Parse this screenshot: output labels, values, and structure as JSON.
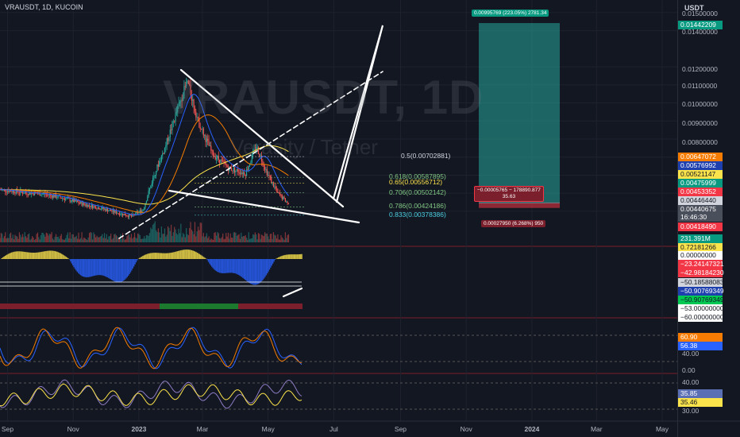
{
  "header": {
    "symbol": "VRAUSDT",
    "interval": "1D",
    "exchange": "KUCOIN",
    "separator": ", "
  },
  "watermark": {
    "symbol": "VRAUSDT",
    "interval_suffix": ", 1D",
    "description": "Verasity / Tether"
  },
  "price_axis": {
    "currency": "USDT",
    "labels": [
      "0.01500000",
      "0.01400000",
      "0.01200000",
      "0.01100000",
      "0.01000000",
      "0.00900000",
      "0.00800000"
    ]
  },
  "price_tags": [
    {
      "text": "0.01442209",
      "bg": "#089981",
      "fg": "#ffffff"
    },
    {
      "text": "0.00647072",
      "bg": "#f57c00",
      "fg": "#ffffff"
    },
    {
      "text": "0.00576992",
      "bg": "#1e40af",
      "fg": "#ffffff"
    },
    {
      "text": "0.00521147",
      "bg": "#fbe34b",
      "fg": "#131722"
    },
    {
      "text": "0.00475999",
      "bg": "#089981",
      "fg": "#ffffff"
    },
    {
      "text": "0.00453352",
      "bg": "#f23645",
      "fg": "#ffffff"
    },
    {
      "text": "0.00446440",
      "bg": "#d1d4dc",
      "fg": "#131722"
    },
    {
      "text": "0.00440675",
      "bg": "#4a4f5c",
      "fg": "#ffffff"
    },
    {
      "text": "16:46:30",
      "bg": "#4a4f5c",
      "fg": "#ffffff"
    },
    {
      "text": "0.00418490",
      "bg": "#f23645",
      "fg": "#ffffff"
    },
    {
      "text": "231.391M",
      "bg": "#089981",
      "fg": "#ffffff"
    },
    {
      "text": "0.72181266",
      "bg": "#fbe34b",
      "fg": "#131722"
    },
    {
      "text": "0.00000000",
      "bg": "#ffffff",
      "fg": "#131722"
    },
    {
      "text": "−23.24147321",
      "bg": "#f23645",
      "fg": "#ffffff"
    },
    {
      "text": "−42.98184230",
      "bg": "#f23645",
      "fg": "#ffffff"
    },
    {
      "text": "−50.18588083",
      "bg": "#d1d4dc",
      "fg": "#131722"
    },
    {
      "text": "−50.90769349",
      "bg": "#1e40af",
      "fg": "#ffffff"
    },
    {
      "text": "−50.90769349",
      "bg": "#00c853",
      "fg": "#131722"
    },
    {
      "text": "−53.00000000",
      "bg": "#ffffff",
      "fg": "#131722"
    },
    {
      "text": "−60.00000000",
      "bg": "#ffffff",
      "fg": "#131722"
    }
  ],
  "stoch_axis": {
    "tags": [
      {
        "text": "60.90",
        "bg": "#f57c00",
        "fg": "#ffffff"
      },
      {
        "text": "56.38",
        "bg": "#2962ff",
        "fg": "#ffffff"
      }
    ],
    "labels": [
      "40.00",
      "0.00"
    ]
  },
  "rsi_axis": {
    "labels": [
      "40.00",
      "30.00"
    ],
    "tags": [
      {
        "text": "35.85",
        "bg": "#5b6fb5",
        "fg": "#ffffff"
      },
      {
        "text": "35.46",
        "bg": "#fbe34b",
        "fg": "#131722"
      }
    ]
  },
  "fib_levels": [
    {
      "label": "0.5(0.00702881)",
      "color": "#d1d4dc"
    },
    {
      "label": "0.618(0.00587895)",
      "color": "#81c784"
    },
    {
      "label": "0.65(0.00556712)",
      "color": "#fbe34b"
    },
    {
      "label": "0.706(0.00502142)",
      "color": "#81c784"
    },
    {
      "label": "0.786(0.00424186)",
      "color": "#81c784"
    },
    {
      "label": "0.833(0.00378386)",
      "color": "#4dd0e1"
    }
  ],
  "position_tool": {
    "target_label": "0.00995769 (223.05%) 2781.34",
    "pnl_label": "−0.00005765 − 178890.877",
    "ratio_label": "35.63",
    "stop_label": "0.00027950 (6.268%) 950"
  },
  "x_axis": {
    "labels": [
      "Sep",
      "Nov",
      "2023",
      "Mar",
      "May",
      "Jul",
      "Sep",
      "Nov",
      "2024",
      "Mar",
      "May"
    ]
  },
  "colors": {
    "background": "#131722",
    "up": "#26a69a",
    "down": "#ef5350",
    "ema_slow": "#fbe34b",
    "ema_fast": "#f57c00",
    "drawing": "#ffffff"
  },
  "chart_data": {
    "type": "line",
    "title": "VRAUSDT, 1D, KUCOIN",
    "xlabel": "",
    "ylabel": "USDT",
    "x_range": [
      "2022-08-25",
      "2024-05-15"
    ],
    "ylim": [
      0.0035,
      0.0152
    ],
    "grid": true,
    "series": [
      {
        "values": [
          [
            "2022-08-25",
            0.0052
          ],
          [
            "2022-09-15",
            0.00505
          ],
          [
            "2022-10-05",
            0.00495
          ],
          [
            "2022-10-25",
            0.0047
          ],
          [
            "2022-11-10",
            0.0044
          ],
          [
            "2022-11-25",
            0.0042
          ],
          [
            "2022-12-10",
            0.00395
          ],
          [
            "2022-12-25",
            0.00372
          ],
          [
            "2023-01-05",
            0.0041
          ],
          [
            "2023-01-15",
            0.006
          ],
          [
            "2023-01-25",
            0.0075
          ],
          [
            "2023-02-05",
            0.0095
          ],
          [
            "2023-02-15",
            0.0112
          ],
          [
            "2023-02-25",
            0.009
          ],
          [
            "2023-03-10",
            0.0072
          ],
          [
            "2023-03-25",
            0.0064
          ],
          [
            "2023-04-10",
            0.0061
          ],
          [
            "2023-04-20",
            0.0076
          ],
          [
            "2023-05-01",
            0.006
          ],
          [
            "2023-05-10",
            0.005
          ],
          [
            "2023-05-20",
            0.00441
          ]
        ]
      }
    ],
    "fibonacci": [
      {
        "level": 0.5,
        "price": 0.00702881
      },
      {
        "level": 0.618,
        "price": 0.00587895
      },
      {
        "level": 0.65,
        "price": 0.00556712
      },
      {
        "level": 0.706,
        "price": 0.00502142
      },
      {
        "level": 0.786,
        "price": 0.00424186
      },
      {
        "level": 0.833,
        "price": 0.00378386
      }
    ],
    "long_position": {
      "entry": 0.0044644,
      "target": 0.01442209,
      "stop": 0.0041849,
      "target_pct": 223.05,
      "stop_pct": 6.268
    },
    "oscillators": {
      "stoch_rsi": {
        "k": 60.9,
        "d": 56.38,
        "levels": [
          40.0,
          0.0
        ]
      },
      "rsi": {
        "value": 35.85,
        "ma": 35.46,
        "levels": [
          40.0,
          30.0
        ]
      }
    }
  }
}
